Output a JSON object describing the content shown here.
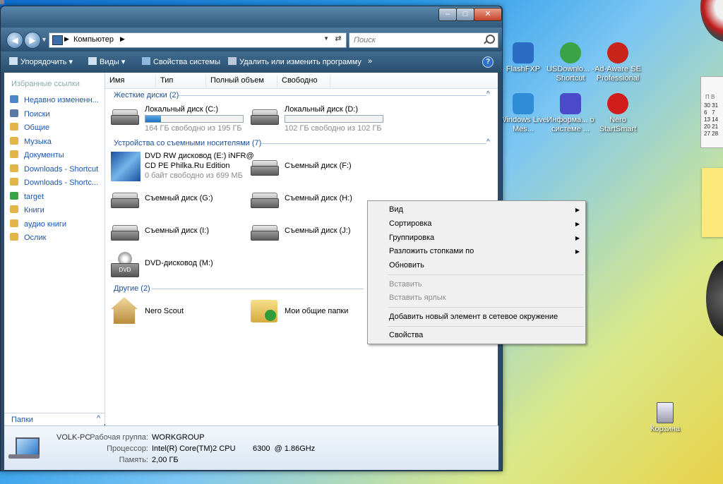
{
  "window": {
    "address": "Компьютер",
    "search_placeholder": "Поиск",
    "toolbar": {
      "organize": "Упорядочить",
      "views": "Виды",
      "system_properties": "Свойства системы",
      "uninstall": "Удалить или изменить программу",
      "more": "»"
    },
    "favorites_title": "Избранные ссылки",
    "favorites": [
      {
        "label": "Недавно измененн...",
        "icon": "recent-icon"
      },
      {
        "label": "Поиски",
        "icon": "search-folder-icon"
      },
      {
        "label": "Общие",
        "icon": "folder-icon"
      },
      {
        "label": "Музыка",
        "icon": "music-icon"
      },
      {
        "label": "Документы",
        "icon": "documents-icon"
      },
      {
        "label": "Downloads - Shortcut",
        "icon": "folder-icon"
      },
      {
        "label": "Downloads - Shortc...",
        "icon": "folder-icon"
      },
      {
        "label": "target",
        "icon": "target-icon"
      },
      {
        "label": "Книги",
        "icon": "folder-icon"
      },
      {
        "label": "аудио книги",
        "icon": "folder-icon"
      },
      {
        "label": "Ослик",
        "icon": "folder-icon"
      }
    ],
    "folders_label": "Папки",
    "columns": [
      "Имя",
      "Тип",
      "Полный объем",
      "Свободно"
    ],
    "groups": {
      "hard_disks": "Жесткие диски (2)",
      "removable": "Устройства со съемными носителями (7)",
      "other": "Другие (2)"
    },
    "drives": {
      "c": {
        "name": "Локальный диск (C:)",
        "free": "164 ГБ свободно из 195 ГБ",
        "used_fraction": 0.16
      },
      "d": {
        "name": "Локальный диск (D:)",
        "free": "102 ГБ свободно из 102 ГБ",
        "used_fraction": 0.0
      },
      "e": {
        "name1": "DVD RW дисковод (E:) iNFR@",
        "name2": "CD PE Philka.Ru Edition",
        "free": "0 байт свободно из 699 МБ"
      },
      "f": {
        "name": "Съемный диск (F:)"
      },
      "g": {
        "name": "Съемный диск (G:)"
      },
      "h": {
        "name": "Съемный диск (H:)"
      },
      "i": {
        "name": "Съемный диск (I:)"
      },
      "j": {
        "name": "Съемный диск (J:)"
      },
      "m": {
        "name": "DVD-дисковод (M:)"
      }
    },
    "other_items": {
      "nero_scout": "Nero Scout",
      "shared_folders": "Мои общие папки"
    },
    "details": {
      "pc_name": "VOLK-PC",
      "workgroup_label": "Рабочая группа:",
      "workgroup": "WORKGROUP",
      "cpu_label": "Процессор:",
      "cpu": "Intel(R) Core(TM)2 CPU        6300  @ 1.86GHz",
      "mem_label": "Память:",
      "mem": "2,00 ГБ"
    }
  },
  "context_menu": {
    "view": "Вид",
    "sort": "Сортировка",
    "group": "Группировка",
    "stack": "Разложить стопками по",
    "refresh": "Обновить",
    "paste": "Вставить",
    "paste_shortcut": "Вставить ярлык",
    "add_network": "Добавить новый элемент в сетевое окружение",
    "properties": "Свойства"
  },
  "desktop": {
    "icons": {
      "flashfxp": "FlashFXP",
      "usdownloader": "USDownlo... - Shortcut",
      "adaware": "Ad-Aware SE Professional",
      "messenger": "Windows Live Mes...",
      "sysinfo": "Информа... о системе ...",
      "nero": "Nero StartSmart",
      "recycle": "Корзина"
    },
    "calendar": {
      "title": "П  В",
      "days": "30 31\n6   7\n13 14\n20 21\n27 28"
    },
    "colors": {
      "flashfxp": "#2b6cc4",
      "usd": "#3aa345",
      "adaware": "#c8241a",
      "messenger": "#2f8cd6",
      "sysinfo": "#4b4bc9",
      "nero": "#d21d1d"
    }
  }
}
